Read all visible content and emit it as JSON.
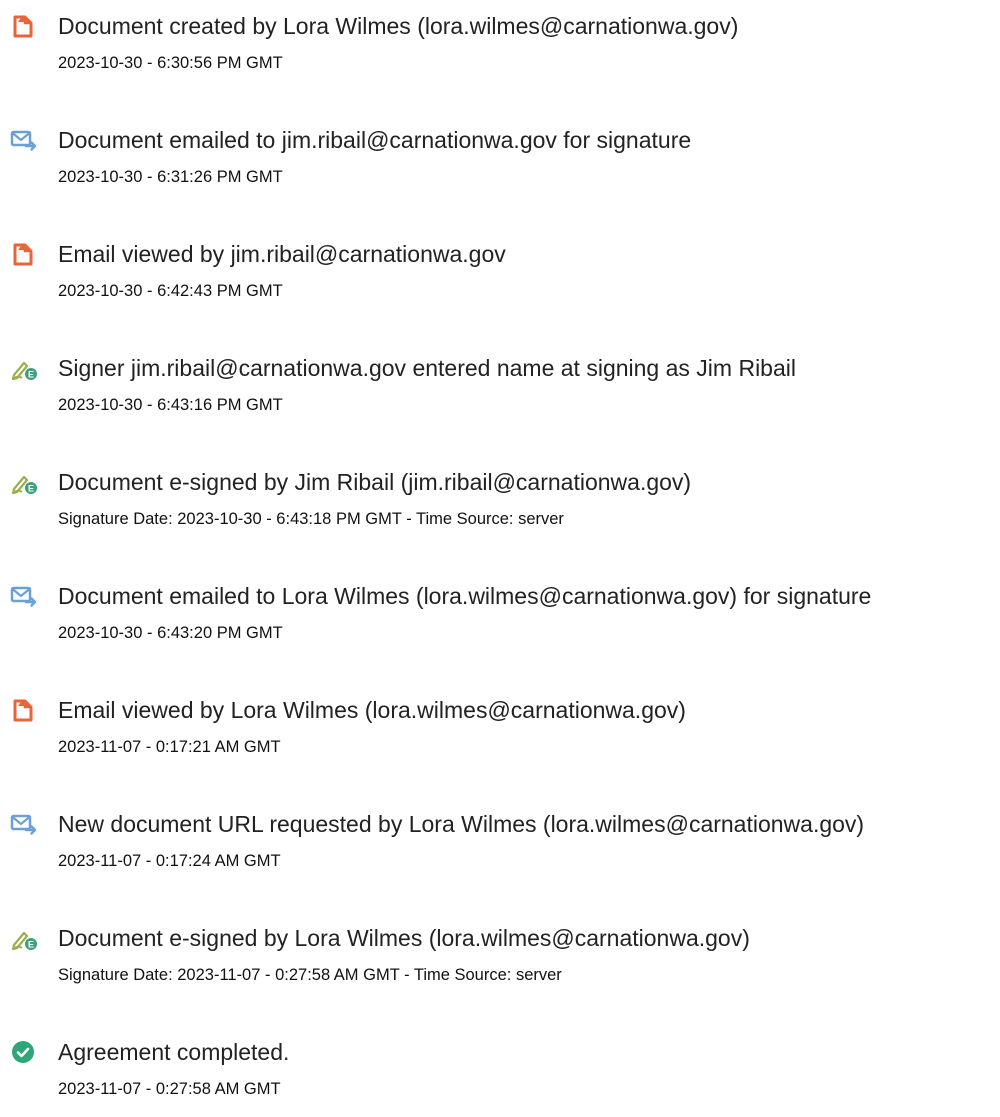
{
  "events": [
    {
      "icon": "document-created-icon",
      "title": "Document created by Lora Wilmes (lora.wilmes@carnationwa.gov)",
      "detail": "2023-10-30 - 6:30:56 PM GMT"
    },
    {
      "icon": "email-sent-icon",
      "title": "Document emailed to jim.ribail@carnationwa.gov for signature",
      "detail": "2023-10-30 - 6:31:26 PM GMT"
    },
    {
      "icon": "document-viewed-icon",
      "title": "Email viewed by jim.ribail@carnationwa.gov",
      "detail": "2023-10-30 - 6:42:43 PM GMT"
    },
    {
      "icon": "e-sign-icon",
      "title": "Signer jim.ribail@carnationwa.gov entered name at signing as Jim Ribail",
      "detail": "2023-10-30 - 6:43:16 PM GMT"
    },
    {
      "icon": "e-sign-icon",
      "title": "Document e-signed by Jim Ribail (jim.ribail@carnationwa.gov)",
      "detail": "Signature Date: 2023-10-30 - 6:43:18 PM GMT - Time Source: server"
    },
    {
      "icon": "email-sent-icon",
      "title": "Document emailed to Lora Wilmes (lora.wilmes@carnationwa.gov) for signature",
      "detail": "2023-10-30 - 6:43:20 PM GMT"
    },
    {
      "icon": "document-viewed-icon",
      "title": "Email viewed by Lora Wilmes (lora.wilmes@carnationwa.gov)",
      "detail": "2023-11-07 - 0:17:21 AM GMT"
    },
    {
      "icon": "email-sent-icon",
      "title": "New document URL requested by Lora Wilmes (lora.wilmes@carnationwa.gov)",
      "detail": "2023-11-07 - 0:17:24 AM GMT"
    },
    {
      "icon": "e-sign-icon",
      "title": "Document e-signed by Lora Wilmes (lora.wilmes@carnationwa.gov)",
      "detail": "Signature Date: 2023-11-07 - 0:27:58 AM GMT - Time Source: server"
    },
    {
      "icon": "check-circle-icon",
      "title": "Agreement completed.",
      "detail": "2023-11-07 - 0:27:58 AM GMT"
    }
  ],
  "colors": {
    "document_icon": "#e8643c",
    "email_icon": "#6aa0d8",
    "sign_icon": "#9ab04a",
    "sign_badge": "#3aa17e",
    "check_icon": "#2da67a"
  }
}
